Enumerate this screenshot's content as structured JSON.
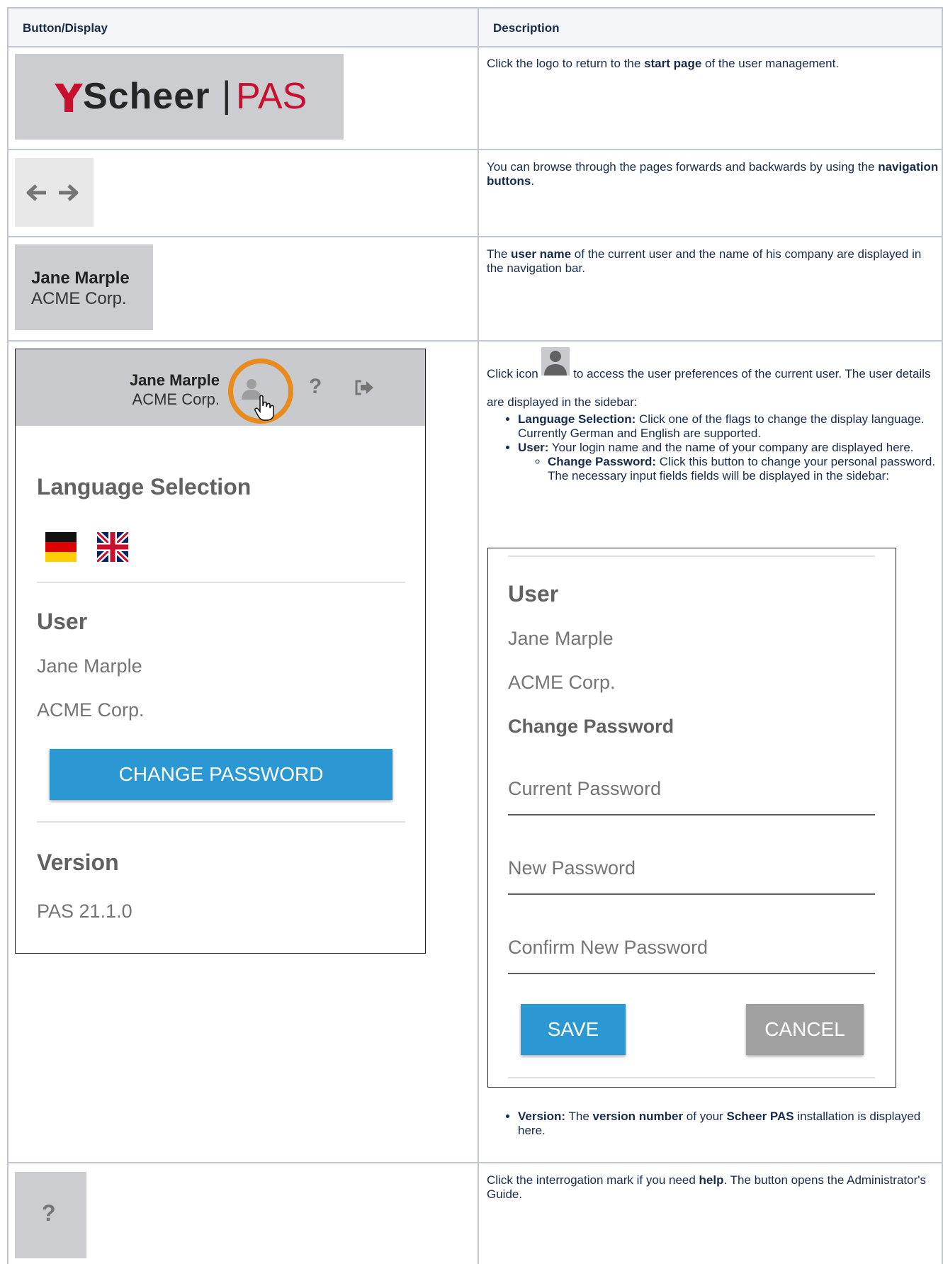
{
  "table": {
    "headers": [
      "Button/Display",
      "Description"
    ]
  },
  "rows": {
    "logo": {
      "logo_brand": "Scheer",
      "logo_separator": "|",
      "logo_product": "PAS",
      "desc_before": "Click the logo to return to the ",
      "desc_bold": "start page",
      "desc_after": " of the user management."
    },
    "nav": {
      "desc_before": "You can browse through the pages forwards and backwards by using the ",
      "desc_bold": "navigation buttons",
      "desc_after": "."
    },
    "user": {
      "name": "Jane Marple",
      "company": "ACME Corp.",
      "desc_1": "The ",
      "desc_bold": "user name",
      "desc_2": " of the current user and the name of his company are displayed in the navigation bar."
    },
    "prefs": {
      "desc_1": "Click icon ",
      "desc_2": " to access the user preferences of the current user. The user details are displayed in the sidebar:",
      "bullets": [
        {
          "bold": "Language Selection:",
          "text": " Click one of the flags to change the display language. Currently German and English are supported."
        },
        {
          "bold": "User:",
          "text": " Your login name and the name of your company are displayed here."
        }
      ],
      "sub_bullet": {
        "bold": "Change Password:",
        "text": " Click this button to change your personal password. The necessary input fields fields will be displayed in the sidebar:"
      },
      "version_bullet": {
        "bold1": "Version:",
        "t1": " The ",
        "bold2": "version number",
        "t2": " of your ",
        "bold3": "Scheer PAS",
        "t3": " installation is displayed here."
      }
    },
    "help": {
      "glyph": "?",
      "desc_before": "Click the interrogation mark if you need ",
      "desc_bold": "help",
      "desc_after": ". The button opens the Administrator's Guide."
    }
  },
  "sidebar": {
    "name": "Jane Marple",
    "company": "ACME Corp.",
    "help_glyph": "?",
    "language_heading": "Language Selection",
    "user_heading": "User",
    "user_name": "Jane Marple",
    "user_company": "ACME Corp.",
    "change_password_button": "CHANGE PASSWORD",
    "version_heading": "Version",
    "version_value": "PAS 21.1.0"
  },
  "password_panel": {
    "user_heading": "User",
    "user_name": "Jane Marple",
    "user_company": "ACME Corp.",
    "change_password_heading": "Change Password",
    "current_password": "Current Password",
    "new_password": "New Password",
    "confirm_password": "Confirm New Password",
    "save": "SAVE",
    "cancel": "CANCEL"
  },
  "colors": {
    "accent_blue": "#2b98d4",
    "logo_red": "#c8102e",
    "highlight_orange": "#e98a1d",
    "border": "#c1c7d0"
  },
  "icons": [
    "back-arrow-icon",
    "forward-arrow-icon",
    "user-icon",
    "help-icon",
    "logout-icon",
    "pointer-hand-icon",
    "german-flag-icon",
    "uk-flag-icon"
  ]
}
